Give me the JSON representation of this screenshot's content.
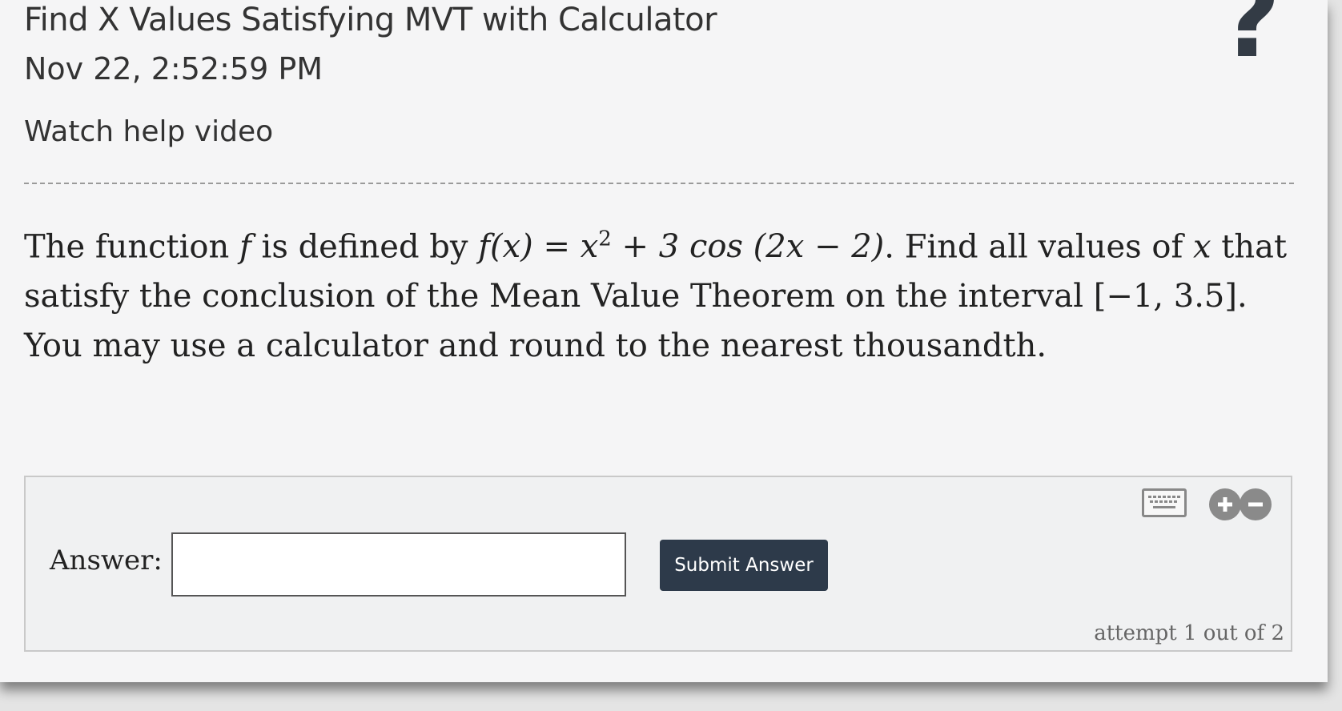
{
  "header": {
    "title": "Find X Values Satisfying MVT with Calculator",
    "timestamp": "Nov 22, 2:52:59 PM",
    "help_link": "Watch help video",
    "help_icon": "?"
  },
  "problem": {
    "part1": "The function",
    "f": "f",
    "part2": "is defined by",
    "lhs": "f(x) = x",
    "exp": "2",
    "rhs": " + 3 cos (2x − 2)",
    "part3": ". Find all values of",
    "x": "x",
    "part4": "that satisfy the conclusion of the Mean Value Theorem on the interval",
    "interval": "[−1, 3.5]",
    "part5": ". You may use a calculator and round to the nearest thousandth."
  },
  "answer": {
    "label": "Answer:",
    "value": "",
    "placeholder": "",
    "submit_label": "Submit Answer",
    "attempt_text": "attempt 1 out of 2"
  },
  "icons": {
    "keyboard": "keyboard-icon",
    "zoom_in": "plus-circle-icon",
    "zoom_out": "minus-circle-icon",
    "help": "question-mark-icon"
  }
}
